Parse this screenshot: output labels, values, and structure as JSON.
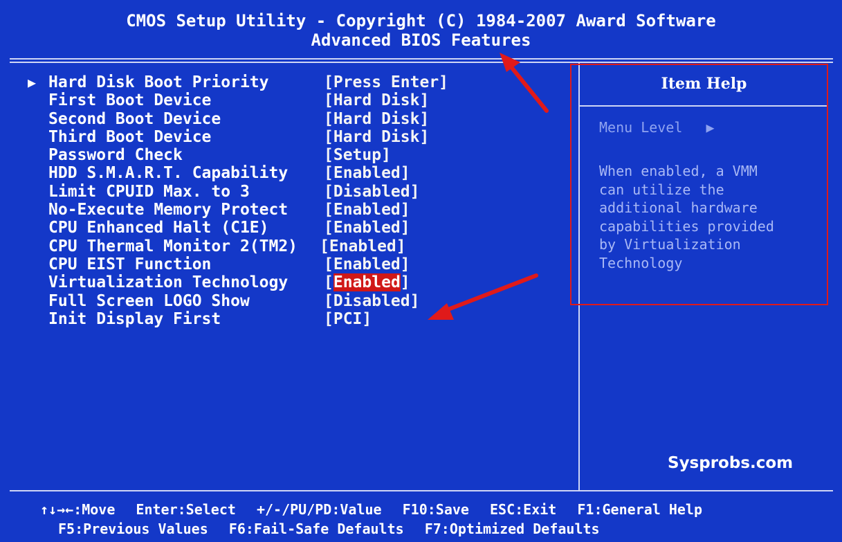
{
  "header": {
    "title": "CMOS Setup Utility - Copyright (C) 1984-2007 Award Software",
    "subtitle": "Advanced BIOS Features"
  },
  "menu": {
    "items": [
      {
        "label": "Hard Disk Boot Priority",
        "value": "[Press Enter]",
        "submenu": true
      },
      {
        "label": "First Boot Device",
        "value": "[Hard Disk]"
      },
      {
        "label": "Second Boot Device",
        "value": "[Hard Disk]"
      },
      {
        "label": "Third Boot Device",
        "value": "[Hard Disk]"
      },
      {
        "label": "Password Check",
        "value": "[Setup]"
      },
      {
        "label": "HDD S.M.A.R.T. Capability",
        "value": "[Enabled]"
      },
      {
        "label": "Limit CPUID Max. to 3",
        "value": "[Disabled]"
      },
      {
        "label": "No-Execute Memory Protect",
        "value": "[Enabled]"
      },
      {
        "label": "CPU Enhanced Halt (C1E)",
        "value": "[Enabled]"
      },
      {
        "label": "CPU Thermal Monitor 2(TM2)",
        "value": "[Enabled]"
      },
      {
        "label": "CPU EIST Function",
        "value": "[Enabled]"
      },
      {
        "label": "Virtualization Technology",
        "value_prefix": "[",
        "value_selected": "Enabled",
        "value_suffix": "]",
        "selected": true
      },
      {
        "label": "Full Screen LOGO Show",
        "value": "[Disabled]"
      },
      {
        "label": "Init Display First",
        "value": "[PCI]"
      }
    ],
    "submenu_arrow": "▶"
  },
  "help": {
    "title": "Item Help",
    "menu_level": "Menu Level",
    "menu_level_arrow": "▶",
    "text_lines": [
      "When enabled, a VMM",
      "can utilize the",
      "additional hardware",
      "capabilities provided",
      "by Virtualization",
      "Technology"
    ]
  },
  "watermark": "Sysprobs.com",
  "footer": {
    "line1": [
      "↑↓→←:Move",
      "Enter:Select",
      "+/-/PU/PD:Value",
      "F10:Save",
      "ESC:Exit",
      "F1:General Help"
    ],
    "line2": [
      "F5:Previous Values",
      "F6:Fail-Safe Defaults",
      "F7:Optimized Defaults"
    ]
  },
  "colors": {
    "background": "#1438c8",
    "text": "#ffffff",
    "highlight": "#d01818",
    "annotation_red": "#e01a1a"
  }
}
